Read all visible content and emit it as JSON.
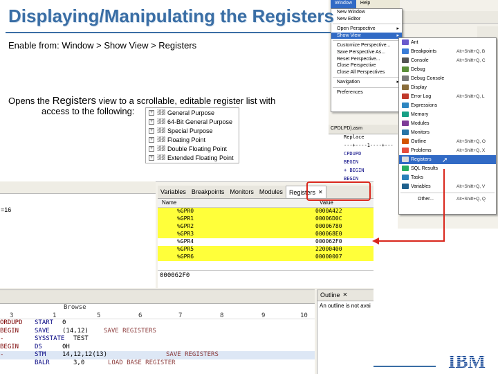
{
  "slide": {
    "title": "Displaying/Manipulating the Registers",
    "enable_prefix": "Enable from: ",
    "enable_path": "Window  >  Show View  >  Registers",
    "opens_a": "Opens the ",
    "opens_b": "Registers",
    "opens_c": " view to a scrollable, editable register list with",
    "opens_d": "access to the following:",
    "categories": [
      "General Purpose",
      "64-Bit General Purpose",
      "Special Purpose",
      "Floating Point",
      "Double Floating Point",
      "Extended Floating Point"
    ]
  },
  "menubar": {
    "window": "Window",
    "help": "Help"
  },
  "window_menu": {
    "items": [
      "New Window",
      "New Editor",
      "Open Perspective",
      "Show View",
      "Customize Perspective...",
      "Save Perspective As...",
      "Reset Perspective...",
      "Close Perspective",
      "Close All Perspectives",
      "Navigation",
      "Preferences"
    ]
  },
  "show_view_menu": {
    "items": [
      {
        "label": "Ant",
        "shortcut": ""
      },
      {
        "label": "Breakpoints",
        "shortcut": "Alt+Shift+Q, B"
      },
      {
        "label": "Console",
        "shortcut": "Alt+Shift+Q, C"
      },
      {
        "label": "Debug",
        "shortcut": ""
      },
      {
        "label": "Debug Console",
        "shortcut": ""
      },
      {
        "label": "Display",
        "shortcut": ""
      },
      {
        "label": "Error Log",
        "shortcut": "Alt+Shift+Q, L"
      },
      {
        "label": "Expressions",
        "shortcut": ""
      },
      {
        "label": "Memory",
        "shortcut": ""
      },
      {
        "label": "Modules",
        "shortcut": ""
      },
      {
        "label": "Monitors",
        "shortcut": ""
      },
      {
        "label": "Outline",
        "shortcut": "Alt+Shift+Q, O"
      },
      {
        "label": "Problems",
        "shortcut": "Alt+Shift+Q, X"
      },
      {
        "label": "Registers",
        "shortcut": ""
      },
      {
        "label": "SQL Results",
        "shortcut": ""
      },
      {
        "label": "Tasks",
        "shortcut": ""
      },
      {
        "label": "Variables",
        "shortcut": "Alt+Shift+Q, V"
      },
      {
        "label": "Other...",
        "shortcut": "Alt+Shift+Q, Q"
      }
    ]
  },
  "view_tabs": [
    "Variables",
    "Breakpoints",
    "Monitors",
    "Modules",
    "Registers"
  ],
  "registers": {
    "col_name": "Name",
    "col_value": "Value",
    "rows": [
      {
        "name": "%GPR0",
        "value": "0000A422"
      },
      {
        "name": "%GPR1",
        "value": "00006D0C"
      },
      {
        "name": "%GPR2",
        "value": "00006780"
      },
      {
        "name": "%GPR3",
        "value": "000068E0"
      },
      {
        "name": "%GPR4",
        "value": "000062F0"
      },
      {
        "name": "%GPR5",
        "value": "22000400"
      },
      {
        "name": "%GPR6",
        "value": "00000007"
      }
    ],
    "detail": "000062F0"
  },
  "left_pane_fragment": "=16",
  "src_peek": {
    "tab": "CPDLPD).asm",
    "lines": [
      "Replace",
      "---+----1----+---",
      "CPDUPD",
      "BEGIN",
      "+ BEGIN",
      "BEGIN"
    ]
  },
  "editor": {
    "browse": "Browse",
    "ruler": [
      "3",
      "1",
      "5",
      "6",
      "7",
      "8",
      "9",
      "10"
    ],
    "lines": [
      {
        "label": "ORDUPD",
        "op": "START",
        "args": "0",
        "comment": ""
      },
      {
        "label": "BEGIN",
        "op": "SAVE",
        "args": "(14,12)",
        "comment": "SAVE REGISTERS"
      },
      {
        "label": "-",
        "op": "SYSSTATE",
        "args": "TEST",
        "comment": ""
      },
      {
        "label": "BEGIN",
        "op": "DS",
        "args": "0H",
        "comment": ""
      },
      {
        "label": "-",
        "op": "STM",
        "args": "14,12,12(13)",
        "comment": "SAVE REGISTERS"
      },
      {
        "label": "",
        "op": "BALR",
        "args": "3,0",
        "comment": "LOAD BASE REGISTER"
      }
    ]
  },
  "outline": {
    "tab": "Outline",
    "message": "An outline is not avai"
  },
  "logo": "IBM",
  "colors": {
    "title": "#3a6ea5",
    "highlight": "#ffff3a",
    "menu_select": "#316ac5",
    "callout": "#d9261c"
  }
}
